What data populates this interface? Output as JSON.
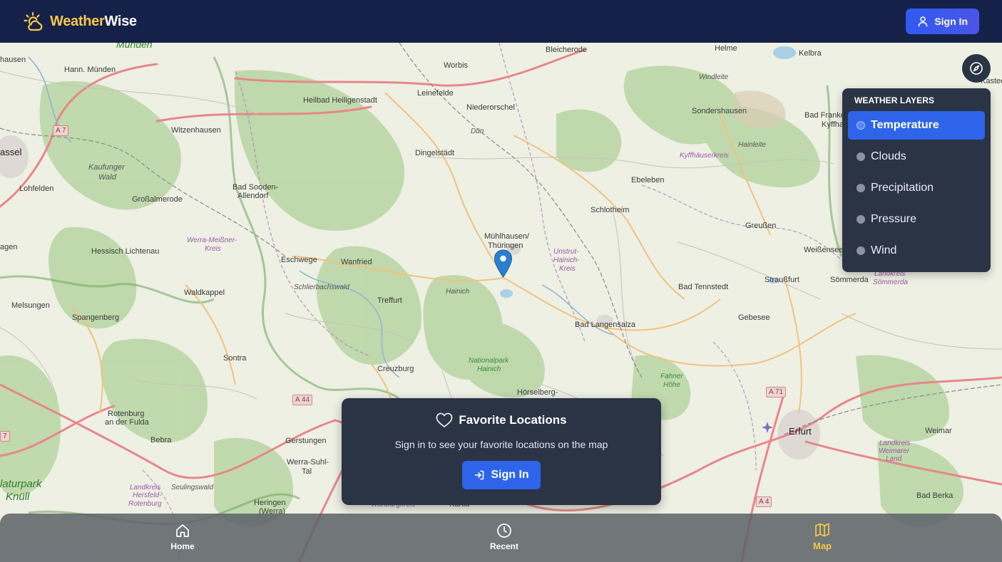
{
  "brand": {
    "part1": "Weather",
    "part2": "Wise"
  },
  "header": {
    "signin_label": "Sign In"
  },
  "layers": {
    "title": "WEATHER LAYERS",
    "items": [
      {
        "label": "Temperature",
        "active": true
      },
      {
        "label": "Clouds",
        "active": false
      },
      {
        "label": "Precipitation",
        "active": false
      },
      {
        "label": "Pressure",
        "active": false
      },
      {
        "label": "Wind",
        "active": false
      }
    ]
  },
  "favorites": {
    "title": "Favorite Locations",
    "subtitle": "Sign in to see your favorite locations on the map",
    "button_label": "Sign In"
  },
  "nav": {
    "items": [
      {
        "label": "Home",
        "icon": "home-icon",
        "active": false
      },
      {
        "label": "Recent",
        "icon": "clock-icon",
        "active": false
      },
      {
        "label": "Map",
        "icon": "map-icon",
        "active": true
      }
    ]
  },
  "map": {
    "labels": {
      "hann_munden": "Hann. Münden",
      "munden": "Münden",
      "hausen": "hausen",
      "bleicherode": "Bleicherode",
      "worbis": "Worbis",
      "helme": "Helme",
      "kelbra": "Kelbra",
      "windleite": "Windleite",
      "heilbad": "Heilbad Heiligenstadt",
      "leinefelde": "Leinefelde",
      "niederorschel": "Niederorschel",
      "sondershausen": "Sondershausen",
      "bad_franke": "Bad Franke",
      "kyffha": "Kyffha",
      "kastedt": "Kastedt",
      "a7": "A 7",
      "witzenhausen": "Witzenhausen",
      "dun": "Dün",
      "hainleite": "Hainleite",
      "kyffhauserkreis": "Kyffhäuserkreis",
      "assel": "assel",
      "dingelstadt": "Dingelstädt",
      "kaufunger1": "Kaufunger",
      "kaufunger2": "Wald",
      "lohfelden": "Lohfelden",
      "sooden1": "Bad Sooden-",
      "sooden2": "Allendorf",
      "grossalmerode": "Großalmerode",
      "ebeleben": "Ebeleben",
      "schlotheim": "Schlotheim",
      "werra1": "Werra-Meißner-",
      "werra2": "Kreis",
      "agen": "agen",
      "hessisch": "Hessisch Lichtenau",
      "muhlhausen1": "Mühlhausen/",
      "muhlhausen2": "Thüringen",
      "unstrut1": "Unstrut-",
      "unstrut2": "Hainich-",
      "unstrut3": "Kreis",
      "greussen": "Greußen",
      "weissensee": "Weißensee",
      "eschwege": "Eschwege",
      "wanfried": "Wanfried",
      "schlierbach": "Schlierbachswald",
      "waldkappel": "Waldkappel",
      "hainich": "Hainich",
      "treffurt": "Treffurt",
      "bad_tennstedt": "Bad Tennstedt",
      "straussfurt": "Straußfurt",
      "sommerda": "Sömmerda",
      "lk_sommerda1": "Landkreis",
      "lk_sommerda2": "Sömmerda",
      "melsungen": "Melsungen",
      "spangenberg": "Spangenberg",
      "gebesee": "Gebesee",
      "bad_langensalza": "Bad Langensalza",
      "np1": "Nationalpark",
      "np2": "Hainich",
      "sontra": "Sontra",
      "creuzburg": "Creuzburg",
      "fahner1": "Fahner",
      "fahner2": "Höhe",
      "horselberg": "Hörselberg-",
      "a44": "A 44",
      "a71": "A 71",
      "rotenburg1": "Rotenburg",
      "rotenburg2": "an der Fulda",
      "erfurt": "Erfurt",
      "weimar": "Weimar",
      "bebra": "Bebra",
      "gerstungen": "Gerstungen",
      "werra_suhl1": "Werra-Suhl-",
      "werra_suhl2": "Tal",
      "lk_weimar1": "Landkreis",
      "lk_weimar2": "Weimarer",
      "lk_weimar3": "Land",
      "naturpark1": "laturpark",
      "naturpark2": "Knüll",
      "lk_hersfeld1": "Landkreis",
      "lk_hersfeld2": "Hersfeld-",
      "lk_hersfeld3": "Rotenburg",
      "seulingswald": "Seulingswald",
      "heringen1": "Heringen",
      "heringen2": "(Werra)",
      "a4": "A 4",
      "bad_berka": "Bad Berka",
      "wartburgkreis": "Wartburgkreis",
      "kahla": "Kahla",
      "a7b": "7"
    }
  },
  "colors": {
    "header_bg": "#16214a",
    "brand_accent": "#f6c945",
    "primary": "#2d64e9",
    "panel_bg": "#2b3445",
    "pin": "#2a7fcf"
  }
}
